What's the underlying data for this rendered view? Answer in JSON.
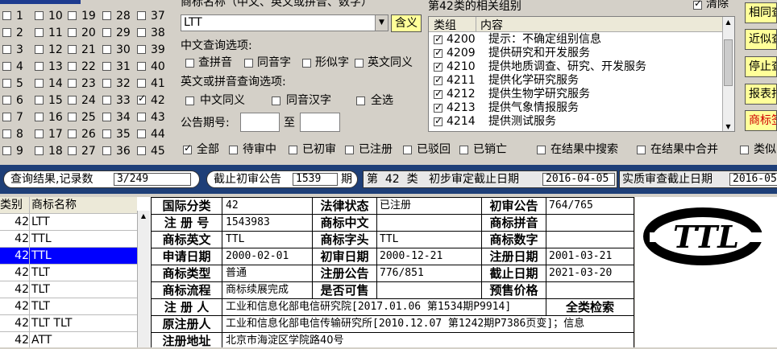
{
  "class_grid": {
    "items": [
      {
        "n": "1",
        "c": false
      },
      {
        "n": "10",
        "c": false
      },
      {
        "n": "19",
        "c": false
      },
      {
        "n": "28",
        "c": false
      },
      {
        "n": "37",
        "c": false
      },
      {
        "n": "2",
        "c": false
      },
      {
        "n": "11",
        "c": false
      },
      {
        "n": "20",
        "c": false
      },
      {
        "n": "29",
        "c": false
      },
      {
        "n": "38",
        "c": false
      },
      {
        "n": "3",
        "c": false
      },
      {
        "n": "12",
        "c": false
      },
      {
        "n": "21",
        "c": false
      },
      {
        "n": "30",
        "c": false
      },
      {
        "n": "39",
        "c": false
      },
      {
        "n": "4",
        "c": false
      },
      {
        "n": "13",
        "c": false
      },
      {
        "n": "22",
        "c": false
      },
      {
        "n": "31",
        "c": false
      },
      {
        "n": "40",
        "c": false
      },
      {
        "n": "5",
        "c": false
      },
      {
        "n": "14",
        "c": false
      },
      {
        "n": "23",
        "c": false
      },
      {
        "n": "32",
        "c": false
      },
      {
        "n": "41",
        "c": false
      },
      {
        "n": "6",
        "c": false
      },
      {
        "n": "15",
        "c": false
      },
      {
        "n": "24",
        "c": false
      },
      {
        "n": "33",
        "c": false
      },
      {
        "n": "42",
        "c": true
      },
      {
        "n": "7",
        "c": false
      },
      {
        "n": "16",
        "c": false
      },
      {
        "n": "25",
        "c": false
      },
      {
        "n": "34",
        "c": false
      },
      {
        "n": "43",
        "c": false
      },
      {
        "n": "8",
        "c": false
      },
      {
        "n": "17",
        "c": false
      },
      {
        "n": "26",
        "c": false
      },
      {
        "n": "35",
        "c": false
      },
      {
        "n": "44",
        "c": false
      },
      {
        "n": "9",
        "c": false
      },
      {
        "n": "18",
        "c": false
      },
      {
        "n": "27",
        "c": false
      },
      {
        "n": "36",
        "c": false
      },
      {
        "n": "45",
        "c": false
      }
    ]
  },
  "search": {
    "name_label": "商标名称（中文、英文或拼音、数字）",
    "name_value": "LTT",
    "meaning_button": "含义",
    "cn_options_label": "中文查询选项:",
    "cn_options": [
      "查拼音",
      "同音字",
      "形似字",
      "英文同义"
    ],
    "en_options_label": "英文或拼音查询选项:",
    "en_options": [
      "中文同义",
      "同音汉字",
      "全选"
    ],
    "issue_label": "公告期号:",
    "issue_to": "至"
  },
  "groups": {
    "title": "第42类的相关组别",
    "clear_label": "清除",
    "clear_checked": true,
    "col_group": "类组",
    "col_content": "内容",
    "rows": [
      {
        "code": "4200",
        "text": "提示：不确定组别信息"
      },
      {
        "code": "4209",
        "text": "提供研究和开发服务"
      },
      {
        "code": "4210",
        "text": "提供地质调查、研究、开发服务"
      },
      {
        "code": "4211",
        "text": "提供化学研究服务"
      },
      {
        "code": "4212",
        "text": "提供生物学研究服务"
      },
      {
        "code": "4213",
        "text": "提供气象情报服务"
      },
      {
        "code": "4214",
        "text": "提供测试服务"
      }
    ]
  },
  "right_buttons": [
    "相同查",
    "近似查",
    "停止查",
    "报表打",
    "商标签"
  ],
  "status_filters": [
    {
      "label": "全部",
      "c": true
    },
    {
      "label": "待审中",
      "c": false
    },
    {
      "label": "已初审",
      "c": false
    },
    {
      "label": "已注册",
      "c": false
    },
    {
      "label": "已驳回",
      "c": false
    },
    {
      "label": "已销亡",
      "c": false
    }
  ],
  "result_options": [
    "在结果中搜索",
    "在结果中合并",
    "类似"
  ],
  "statusbar": {
    "records_label": "查询结果,记录数",
    "records_value": "3/249",
    "cutoff_label": "截止初审公告",
    "cutoff_value": "1539",
    "cutoff_unit": "期",
    "class_text": "第  42  类   初步审定截止日期",
    "prelim_date": "2016-04-05",
    "exam_label": "实质审查截止日期",
    "exam_date": "2016-05"
  },
  "results": {
    "col_class": "类别",
    "col_name": "商标名称",
    "rows": [
      {
        "cls": "42",
        "name": "LTT",
        "sel": false
      },
      {
        "cls": "42",
        "name": "TTL",
        "sel": false
      },
      {
        "cls": "42",
        "name": "TTL",
        "sel": true
      },
      {
        "cls": "42",
        "name": "TLT",
        "sel": false
      },
      {
        "cls": "42",
        "name": "TLT",
        "sel": false
      },
      {
        "cls": "42",
        "name": "TLT",
        "sel": false
      },
      {
        "cls": "42",
        "name": "TLT TLT",
        "sel": false
      },
      {
        "cls": "42",
        "name": "ATT",
        "sel": false
      }
    ]
  },
  "detail": {
    "intl_class_label": "国际分类",
    "intl_class": "42",
    "legal_status_label": "法律状态",
    "legal_status": "已注册",
    "prelim_notice_label": "初审公告",
    "prelim_notice": "764/765",
    "reg_no_label": "注 册 号",
    "reg_no": "1543983",
    "cn_label": "商标中文",
    "cn": "",
    "pinyin_label": "商标拼音",
    "pinyin": "",
    "en_label": "商标英文",
    "en": "TTL",
    "head_label": "商标字头",
    "head": "TTL",
    "digits_label": "商标数字",
    "digits": "",
    "apply_date_label": "申请日期",
    "apply_date": "2000-02-01",
    "prelim_date_label": "初审日期",
    "prelim_date": "2000-12-21",
    "reg_date_label": "注册日期",
    "reg_date": "2001-03-21",
    "type_label": "商标类型",
    "type": "普通",
    "reg_notice_label": "注册公告",
    "reg_notice": "776/851",
    "expire_label": "截止日期",
    "expire": "2021-03-20",
    "flow_label": "商标流程",
    "flow": "商标续展完成",
    "sellable_label": "是否可售",
    "sellable": "",
    "price_label": "预售价格",
    "price": "",
    "registrant_label": "注 册 人",
    "registrant": "工业和信息化部电信研究院[2017.01.06 第1534期P9914]",
    "full_search_label": "全类检索",
    "orig_registrant_label": "原注册人",
    "orig_registrant": "工业和信息化部电信传输研究所[2010.12.07 第1242期P7386页变]；信息",
    "address_label": "注册地址",
    "address": "北京市海淀区学院路40号"
  },
  "logo": {
    "text": "TTL"
  }
}
